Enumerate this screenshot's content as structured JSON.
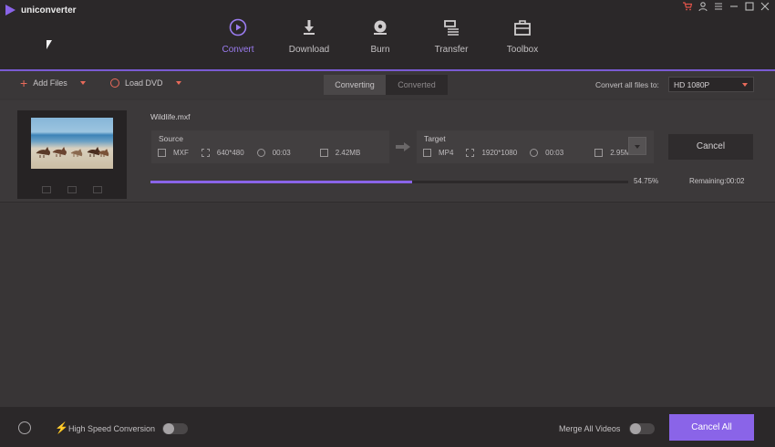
{
  "app": {
    "title": "uniconverter"
  },
  "window_controls": [
    "cart-icon",
    "user-icon",
    "menu-icon",
    "minimize-icon",
    "maximize-icon",
    "close-icon"
  ],
  "nav": {
    "items": [
      {
        "label": "Convert",
        "icon": "convert-icon",
        "active": true
      },
      {
        "label": "Download",
        "icon": "download-icon",
        "active": false
      },
      {
        "label": "Burn",
        "icon": "burn-icon",
        "active": false
      },
      {
        "label": "Transfer",
        "icon": "transfer-icon",
        "active": false
      },
      {
        "label": "Toolbox",
        "icon": "toolbox-icon",
        "active": false
      }
    ]
  },
  "toolbar": {
    "add_files": "Add Files",
    "load_dvd": "Load DVD",
    "tabs": [
      {
        "label": "Converting",
        "selected": true
      },
      {
        "label": "Converted",
        "selected": false
      }
    ],
    "convert_all_label": "Convert all files to:",
    "convert_all_value": "HD 1080P"
  },
  "task": {
    "filename": "Wildlife.mxf",
    "source": {
      "title": "Source",
      "format": "MXF",
      "resolution": "640*480",
      "duration": "00:03",
      "size": "2.42MB"
    },
    "target": {
      "title": "Target",
      "format": "MP4",
      "resolution": "1920*1080",
      "duration": "00:03",
      "size": "2.95MB"
    },
    "cancel_label": "Cancel",
    "progress_percent": 54.75,
    "progress_text": "54.75%",
    "remaining": "Remaining:00:02"
  },
  "bottom": {
    "high_speed_label": "High Speed Conversion",
    "high_speed_on": false,
    "merge_label": "Merge All Videos",
    "merge_on": false,
    "cancel_all_label": "Cancel All"
  },
  "colors": {
    "accent": "#8a64e8",
    "toolbar_icon": "#e86a5a",
    "background": "#383536",
    "header": "#2b2829"
  }
}
